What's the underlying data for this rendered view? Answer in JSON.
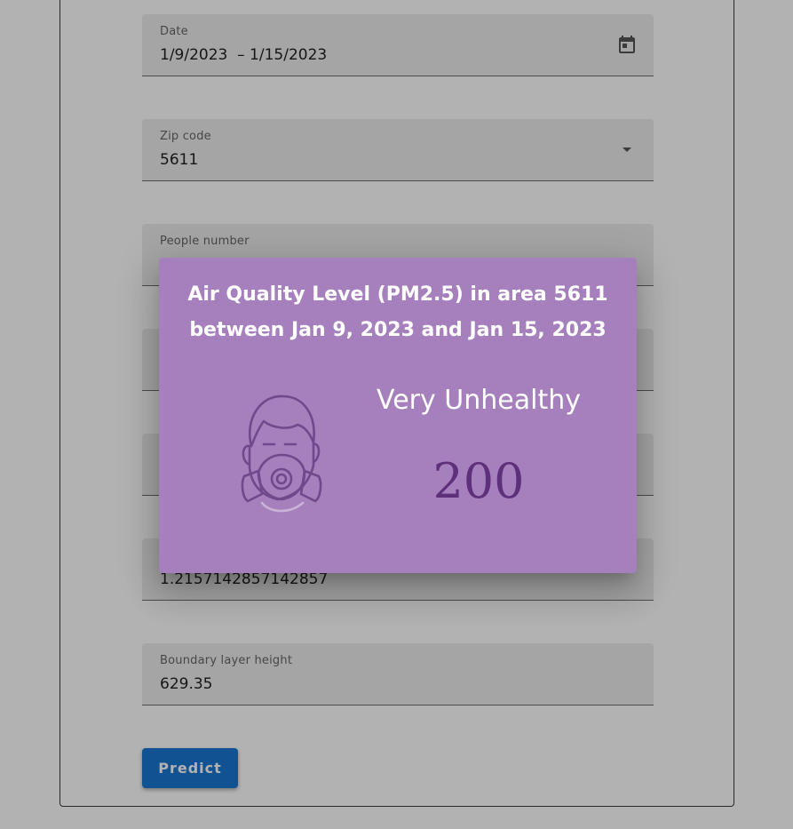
{
  "form": {
    "date": {
      "label": "Date",
      "value": "1/9/2023  – 1/15/2023",
      "icon": "calendar-icon"
    },
    "zip": {
      "label": "Zip code",
      "value": "5611",
      "icon": "chevron-down-icon"
    },
    "people": {
      "label": "People number",
      "value": ""
    },
    "field4": {
      "label": "",
      "value": ""
    },
    "field5": {
      "label": "",
      "value": ""
    },
    "field6": {
      "label": "",
      "value": "1.2157142857142857"
    },
    "boundary": {
      "label": "Boundary layer height",
      "value": "629.35"
    },
    "predict_label": "Predict"
  },
  "dialog": {
    "title_line1": "Air Quality Level (PM2.5) in area 5611",
    "title_line2": "between Jan 9, 2023 and Jan 15, 2023",
    "category": "Very Unhealthy",
    "value": "200",
    "icon": "gas-mask-icon"
  },
  "colors": {
    "dialog_bg": "#a67fbd",
    "value_color": "#5e2f7a",
    "button_bg": "#1976d2"
  }
}
